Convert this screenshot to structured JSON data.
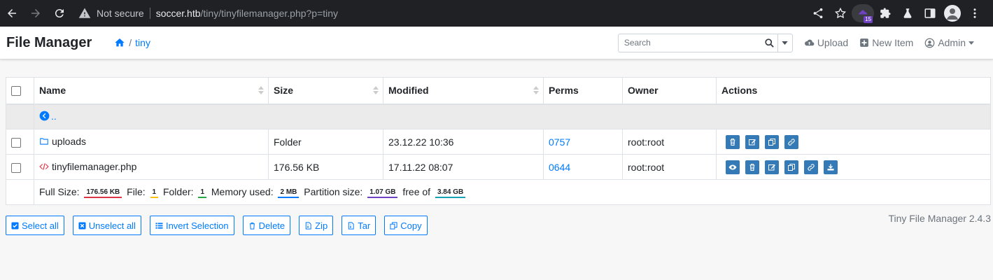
{
  "browser": {
    "not_secure": "Not secure",
    "url_host": "soccer.htb",
    "url_path": "/tiny/tinyfilemanager.php?p=tiny",
    "ext_count": "15"
  },
  "header": {
    "brand": "File Manager",
    "crumb": "tiny",
    "crumb_sep": "/",
    "search_placeholder": "Search",
    "upload": "Upload",
    "new_item": "New Item",
    "admin": "Admin"
  },
  "table": {
    "columns": [
      "Name",
      "Size",
      "Modified",
      "Perms",
      "Owner",
      "Actions"
    ],
    "up_label": "..",
    "rows": [
      {
        "name": "uploads",
        "size": "Folder",
        "modified": "23.12.22 10:36",
        "perms": "0757",
        "owner": "root:root",
        "type": "folder"
      },
      {
        "name": "tinyfilemanager.php",
        "size": "176.56 KB",
        "modified": "17.11.22 08:07",
        "perms": "0644",
        "owner": "root:root",
        "type": "file"
      }
    ],
    "summary": {
      "full_size_label": "Full Size:",
      "full_size": "176.56 KB",
      "file_label": "File:",
      "file": "1",
      "folder_label": "Folder:",
      "folder": "1",
      "memory_label": "Memory used:",
      "memory": "2 MB",
      "partition_label": "Partition size:",
      "partition": "1.07 GB",
      "free_of_label": "free of",
      "free_of": "3.84 GB"
    }
  },
  "bottom": {
    "select_all": "Select all",
    "unselect_all": "Unselect all",
    "invert": "Invert Selection",
    "delete": "Delete",
    "zip": "Zip",
    "tar": "Tar",
    "copy": "Copy",
    "version": "Tiny File Manager 2.4.3"
  },
  "colors": {
    "accent": "#007bff",
    "action_btn": "#337ab7",
    "badge_full_size": "#dc3545",
    "badge_file": "#ffc107",
    "badge_folder": "#28a745",
    "badge_memory": "#007bff",
    "badge_partition": "#6f42c1",
    "badge_free": "#17a2b8"
  }
}
